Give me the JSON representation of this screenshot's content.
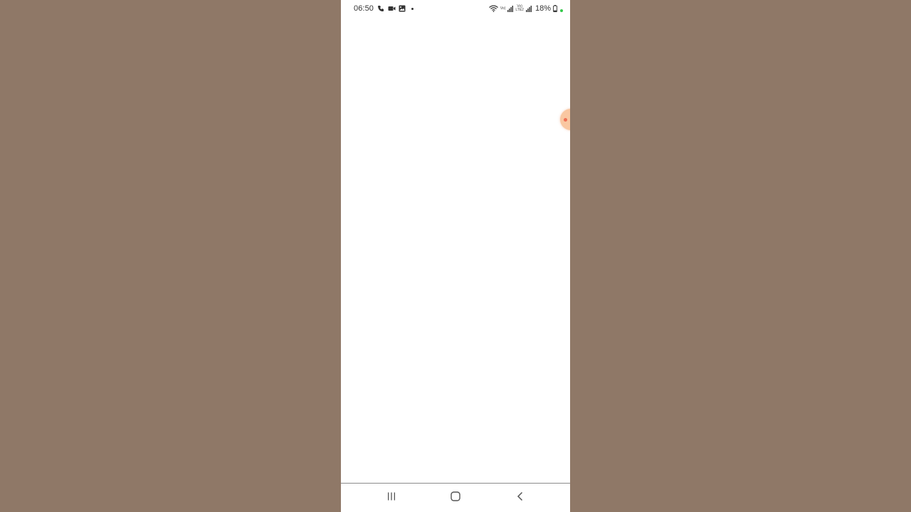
{
  "status_bar": {
    "time": "06:50",
    "left_icons": [
      "call-icon",
      "video-icon",
      "gallery-icon",
      "notification-dot"
    ],
    "right_icons": [
      "wifi-icon",
      "sim1-signal-icon",
      "volte-icon",
      "sim2-signal-icon",
      "battery-icon"
    ],
    "sim1_label": "Vo)",
    "volte_top": "Vo)",
    "volte_bottom": "LTE2",
    "battery_percent": "18%",
    "charging_indicator_color": "#33c84a"
  },
  "content": {
    "floating_bubble": {
      "icon": "chat-head-bubble",
      "color": "#f9c7a1",
      "accent": "#ef6f54"
    }
  },
  "nav_bar": {
    "buttons": [
      "recent-apps-icon",
      "home-icon",
      "back-icon"
    ]
  },
  "colors": {
    "backdrop": "#8f7867",
    "screen": "#ffffff"
  }
}
